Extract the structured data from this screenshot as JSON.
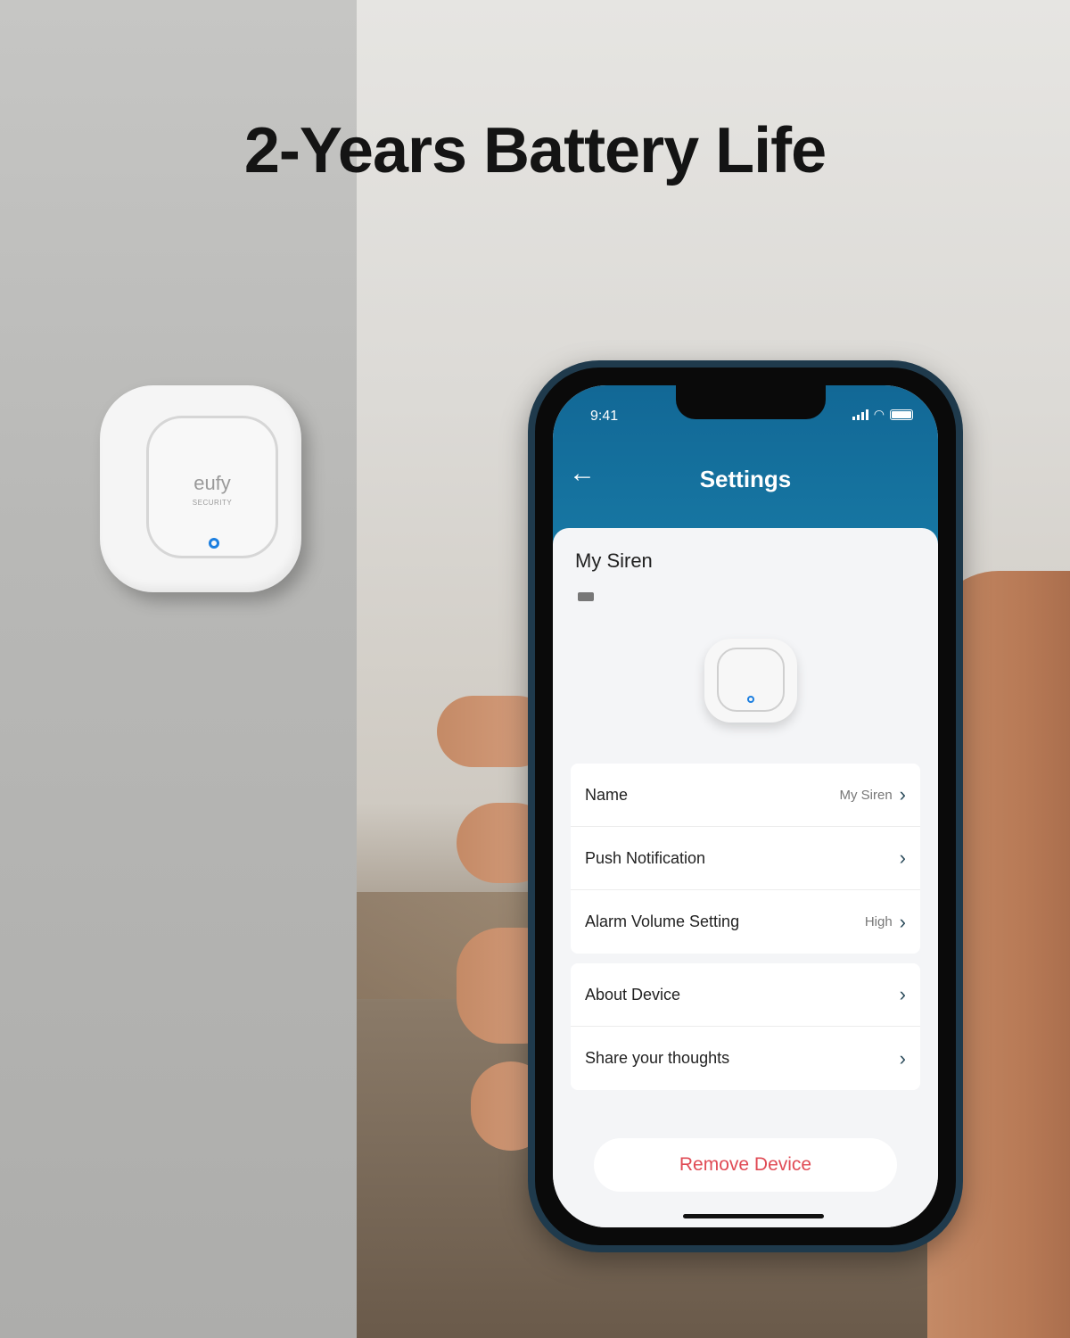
{
  "headline": "2-Years Battery Life",
  "wall_device": {
    "brand": "eufy",
    "sub": "SECURITY"
  },
  "phone": {
    "status_bar": {
      "time": "9:41"
    },
    "header": {
      "title": "Settings",
      "back_icon": "arrow-left-icon"
    },
    "device": {
      "name": "My Siren",
      "battery_icon": "battery-icon"
    },
    "settings_group_1": [
      {
        "label": "Name",
        "value": "My Siren"
      },
      {
        "label": "Push Notification",
        "value": ""
      },
      {
        "label": "Alarm Volume Setting",
        "value": "High"
      }
    ],
    "settings_group_2": [
      {
        "label": "About Device",
        "value": ""
      },
      {
        "label": "Share your thoughts",
        "value": ""
      }
    ],
    "remove_button": "Remove Device",
    "chevron": "›",
    "back_arrow": "←"
  },
  "colors": {
    "header_blue": "#1572a0",
    "remove_red": "#e04b55",
    "led_blue": "#1c7fe0"
  }
}
